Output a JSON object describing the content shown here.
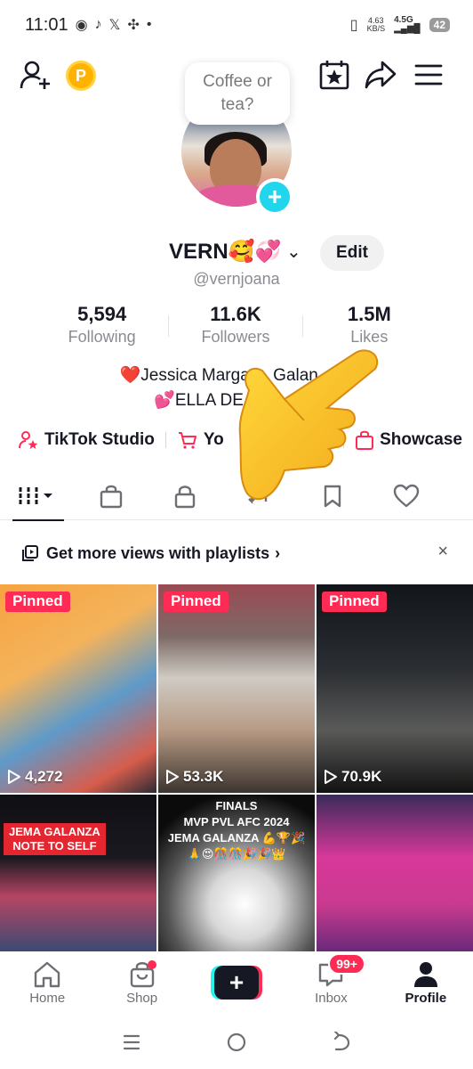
{
  "status_bar": {
    "time": "11:01",
    "net_speed_value": "4.63",
    "net_speed_unit": "KB/S",
    "network": "4.5G",
    "battery": "42"
  },
  "bubble": {
    "text": "Coffee or tea?"
  },
  "profile": {
    "name": "VERN🥰💞",
    "edit_label": "Edit",
    "username": "@vernjoana"
  },
  "stats": [
    {
      "value": "5,594",
      "label": "Following"
    },
    {
      "value": "11.6K",
      "label": "Followers"
    },
    {
      "value": "1.5M",
      "label": "Likes"
    }
  ],
  "bio": {
    "line1": "❤️Jessica Margar... Galan...❤️",
    "line2": "💕ELLA DE JES... 🥰"
  },
  "links": {
    "studio": "TikTok Studio",
    "yours": "Yo",
    "showcase": "Showcase"
  },
  "playlist_banner": {
    "text": "Get more views with playlists",
    "chevron": "›",
    "close": "×"
  },
  "grid": [
    {
      "pinned": "Pinned",
      "views": "4,272"
    },
    {
      "pinned": "Pinned",
      "views": "53.3K"
    },
    {
      "pinned": "Pinned",
      "views": "70.9K"
    },
    {
      "overlay": "JEMA GALANZA\nNOTE TO SELF"
    },
    {
      "overlay": "FINALS\nMVP PVL AFC 2024\nJEMA GALANZA 💪🏆🎉\n🙏😍🎊🎊🎉🎉👑"
    },
    {}
  ],
  "bottom_nav": {
    "home": "Home",
    "shop": "Shop",
    "inbox": "Inbox",
    "inbox_badge": "99+",
    "profile": "Profile",
    "create": "+"
  },
  "colors": {
    "accent": "#fe2c55",
    "cyan": "#25f4ee",
    "text": "#161823",
    "muted": "#8a8b91"
  }
}
